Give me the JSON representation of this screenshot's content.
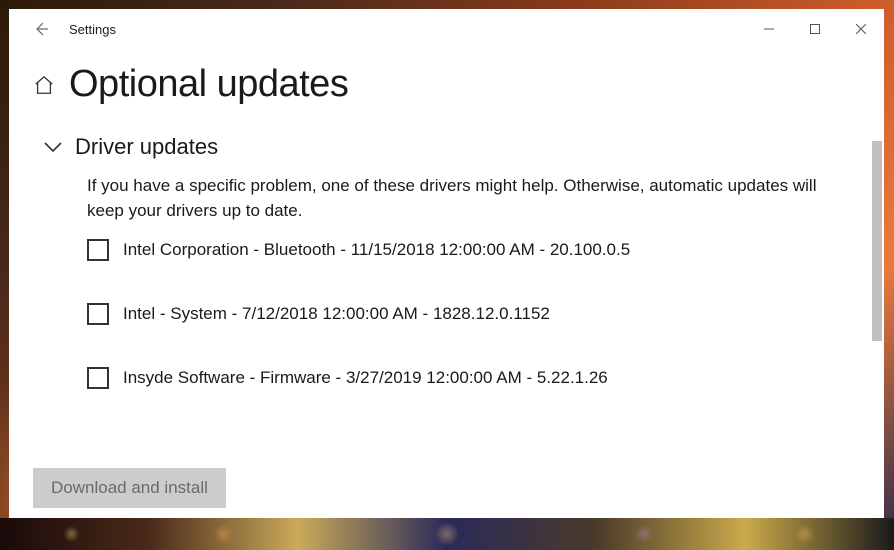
{
  "titlebar": {
    "app_name": "Settings"
  },
  "page": {
    "title": "Optional updates"
  },
  "section": {
    "title": "Driver updates",
    "description": "If you have a specific problem, one of these drivers might help. Otherwise, automatic updates will keep your drivers up to date."
  },
  "updates": [
    {
      "label": "Intel Corporation - Bluetooth - 11/15/2018 12:00:00 AM - 20.100.0.5",
      "checked": false
    },
    {
      "label": "Intel - System - 7/12/2018 12:00:00 AM - 1828.12.0.1152",
      "checked": false
    },
    {
      "label": "Insyde Software - Firmware - 3/27/2019 12:00:00 AM - 5.22.1.26",
      "checked": false
    }
  ],
  "actions": {
    "download_install": "Download and install"
  }
}
